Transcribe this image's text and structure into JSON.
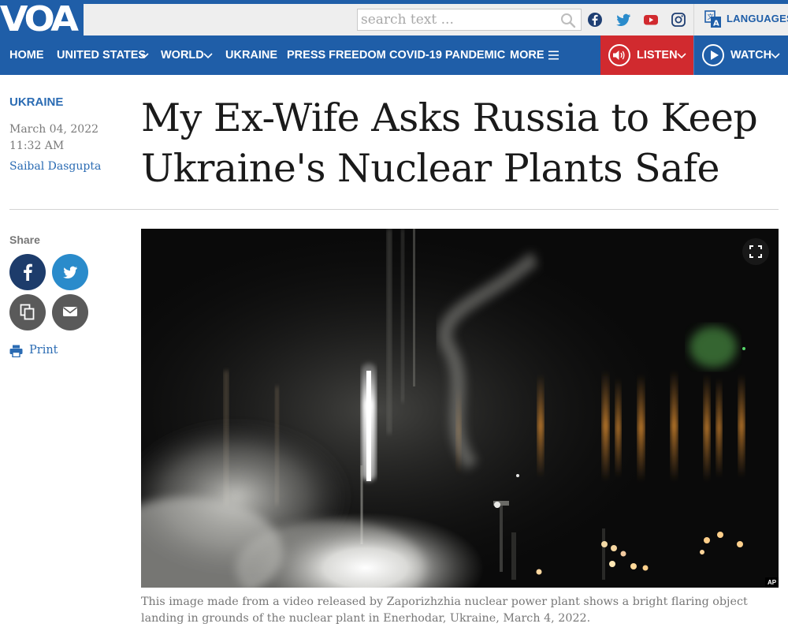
{
  "header": {
    "logo_text": "VOA",
    "search_placeholder": "search text ...",
    "social": [
      "facebook-icon",
      "twitter-icon",
      "youtube-icon",
      "instagram-icon"
    ],
    "languages_label": "LANGUAGES"
  },
  "nav": {
    "items": [
      {
        "label": "HOME",
        "has_dropdown": false
      },
      {
        "label": "UNITED STATES",
        "has_dropdown": true
      },
      {
        "label": "WORLD",
        "has_dropdown": true
      },
      {
        "label": "UKRAINE",
        "has_dropdown": false
      },
      {
        "label": "PRESS FREEDOM",
        "has_dropdown": false
      },
      {
        "label": "COVID-19 PANDEMIC",
        "has_dropdown": false
      },
      {
        "label": "MORE",
        "has_dropdown": false
      }
    ],
    "listen_label": "LISTEN",
    "watch_label": "WATCH"
  },
  "article": {
    "section": "UKRAINE",
    "date": "March 04, 2022",
    "time": "11:32 AM",
    "author": "Saibal Dasgupta",
    "headline": "My Ex-Wife Asks Russia to Keep Ukraine's Nuclear Plants Safe",
    "image_credit": "AP",
    "caption": "This image made from a video released by Zaporizhzhia nuclear power plant shows a bright flaring object landing in grounds of the nuclear plant in Enerhodar, Ukraine, March 4, 2022."
  },
  "share": {
    "label": "Share",
    "print_label": "Print"
  },
  "colors": {
    "brand_blue": "#1f5ea8",
    "listen_red": "#d12a2f",
    "facebook": "#1d3c6b",
    "twitter": "#2a8bcb",
    "copy_email": "#5a5a5a",
    "link_blue": "#2a6bb3"
  }
}
